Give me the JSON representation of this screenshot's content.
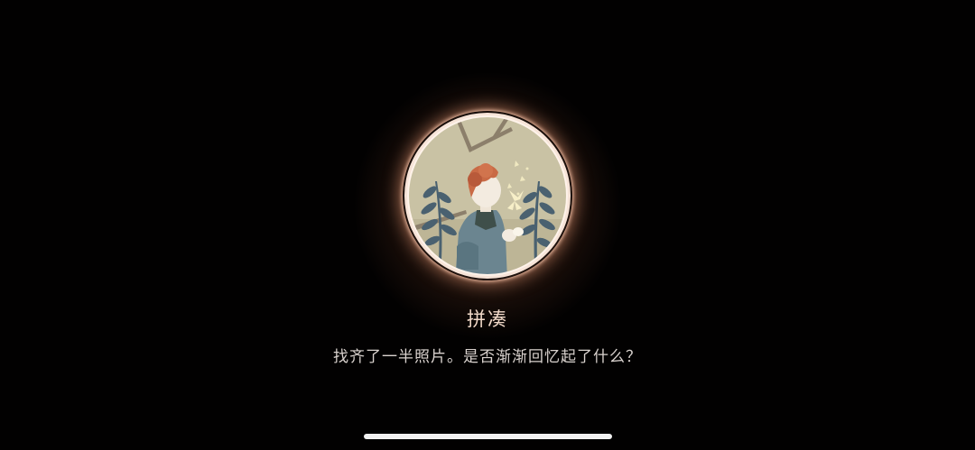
{
  "achievement": {
    "title": "拼凑",
    "description": "找齐了一半照片。是否渐渐回忆起了什么？",
    "image": "boy-holding-butterfly-illustration"
  },
  "colors": {
    "background": "#020101",
    "badge_ring": "#f7e4d8",
    "glow": "#ffa06e",
    "title_text": "#f1d9c9",
    "description_text": "#d9d2ce"
  },
  "system": {
    "home_indicator": "home-indicator-bar"
  }
}
